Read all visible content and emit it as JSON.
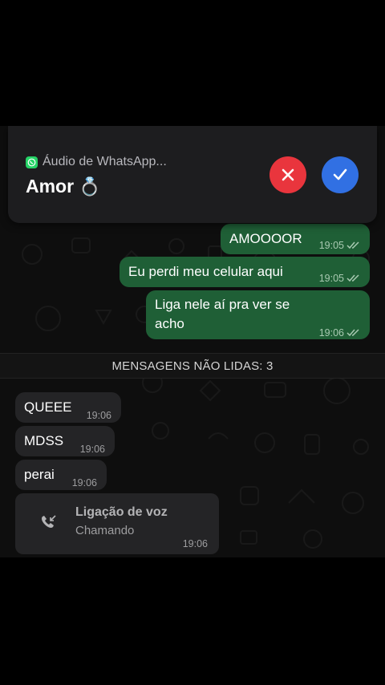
{
  "call": {
    "app_name": "Áudio de WhatsApp...",
    "caller": "Amor",
    "caller_emoji": "💍",
    "decline_icon": "close-icon",
    "accept_icon": "check-icon"
  },
  "outgoing": [
    {
      "text": "AMOOOOR",
      "time": "19:05"
    },
    {
      "text": "Eu perdi meu celular aqui",
      "time": "19:05"
    },
    {
      "text": "Liga nele aí pra ver se acho",
      "time": "19:06"
    }
  ],
  "unread": {
    "label": "MENSAGENS NÃO LIDAS: 3"
  },
  "incoming": [
    {
      "text": "QUEEE",
      "time": "19:06"
    },
    {
      "text": "MDSS",
      "time": "19:06"
    },
    {
      "text": "perai",
      "time": "19:06"
    }
  ],
  "voice_call": {
    "title": "Ligação de voz",
    "status": "Chamando",
    "time": "19:06"
  },
  "colors": {
    "outgoing_bubble": "#1f5f36",
    "incoming_bubble": "#242426",
    "decline": "#e9353d",
    "accept": "#3170e3",
    "whatsapp": "#25d366"
  }
}
